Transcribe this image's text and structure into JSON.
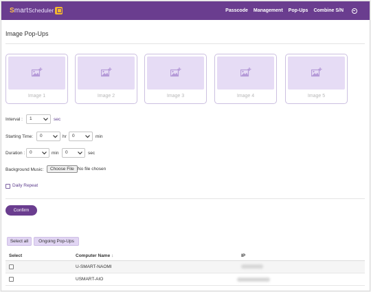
{
  "brand": {
    "name_prefix": "S",
    "name_rest": "mart",
    "name_suffix": "Scheduler"
  },
  "nav": {
    "items": [
      "Passcode",
      "Management",
      "Pop-Ups",
      "Combine S/N"
    ],
    "language_icon": "globe-icon"
  },
  "page": {
    "title": "Image Pop-Ups"
  },
  "images": [
    {
      "label": "Image 1"
    },
    {
      "label": "Image 2"
    },
    {
      "label": "Image 3"
    },
    {
      "label": "Image 4"
    },
    {
      "label": "Image 5"
    }
  ],
  "interval": {
    "label": "Interval :",
    "value": "1",
    "unit": "sec"
  },
  "starting_time": {
    "label": "Starting Time:",
    "hour_value": "0",
    "hour_unit": "hr",
    "min_value": "0",
    "min_unit": "min"
  },
  "duration": {
    "label": "Duration :",
    "min_value": "0",
    "min_unit": "min",
    "sec_value": "0",
    "sec_unit": "sec"
  },
  "background_music": {
    "label": "Background Music:",
    "button": "Choose File",
    "status": "No file chosen"
  },
  "daily_repeat": {
    "label": "Daily Repeat",
    "checked": false
  },
  "confirm": {
    "label": "Confirm"
  },
  "table_actions": {
    "select_all": "Select all",
    "ongoing": "Ongoing Pop-Ups"
  },
  "table": {
    "headers": {
      "select": "Select",
      "computer_name": "Computer Name",
      "sort_icon": "↕",
      "ip": "IP"
    },
    "rows": [
      {
        "computer_name": "U-SMART-NAOMI",
        "checked": false
      },
      {
        "computer_name": "USMART-AIO",
        "checked": false
      }
    ]
  },
  "colors": {
    "primary": "#6a3d8f",
    "accent": "#ffc24a",
    "placeholder_bg": "#e6dcf5",
    "button_light": "#e1d5f3"
  }
}
